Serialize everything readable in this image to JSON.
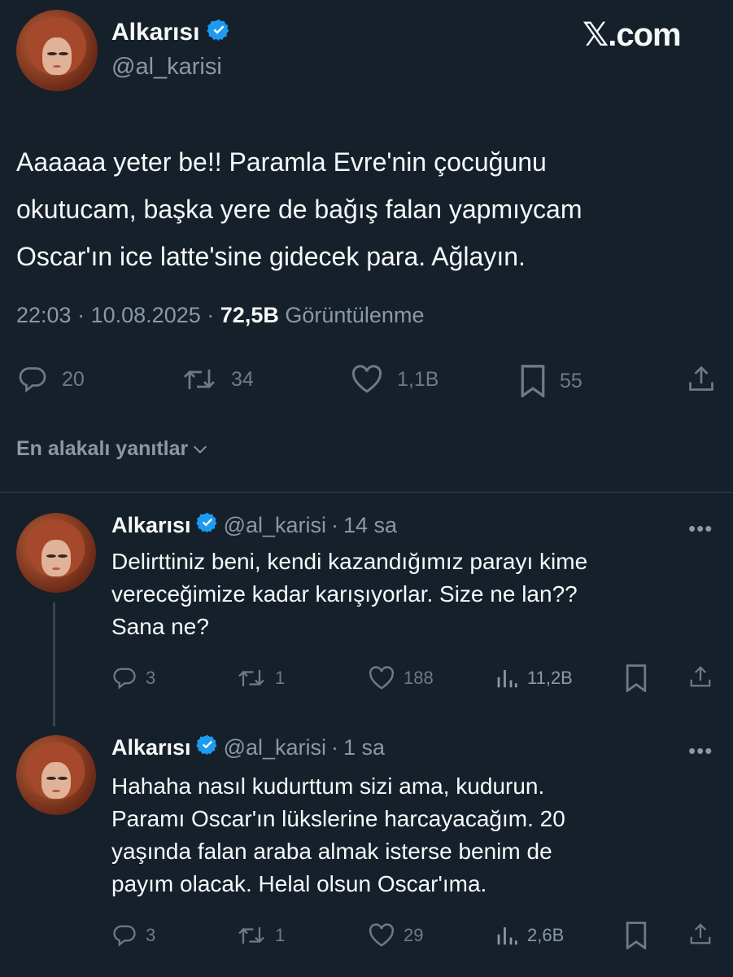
{
  "brand": {
    "logo_text": "𝕏.com"
  },
  "tweet": {
    "name": "Alkarısı",
    "handle": "@al_karisi",
    "text": "Aaaaaa yeter be!! Paramla Evre'nin çocuğunu\nokutucam, başka yere de bağış falan yapmıycam\nOscar'ın ice latte'sine gidecek para. Ağlayın.",
    "time": "22:03",
    "date": "10.08.2025",
    "views_count": "72,5B",
    "views_label": "Görüntülenme",
    "separator": "·",
    "actions": {
      "replies": "20",
      "reposts": "34",
      "likes": "1,1B",
      "bookmarks": "55"
    }
  },
  "sort": {
    "label": "En alakalı yanıtlar"
  },
  "replies": [
    {
      "name": "Alkarısı",
      "handle": "@al_karisi",
      "separator": "·",
      "time": "14 sa",
      "more": "•••",
      "text": "Delirttiniz beni, kendi kazandığımız parayı kime\nvereceğimize kadar karışıyorlar. Size ne lan??\nSana ne?",
      "actions": {
        "replies": "3",
        "reposts": "1",
        "likes": "188",
        "views": "11,2B"
      }
    },
    {
      "name": "Alkarısı",
      "handle": "@al_karisi",
      "separator": "·",
      "time": "1 sa",
      "more": "•••",
      "text": "Hahaha nasıl kudurttum sizi ama, kudurun.\nParamı Oscar'ın lükslerine harcayacağım. 20\nyaşında falan araba almak isterse benim de\npayım olacak. Helal olsun Oscar'ıma.",
      "actions": {
        "replies": "3",
        "reposts": "1",
        "likes": "29",
        "views": "2,6B"
      }
    }
  ],
  "colors": {
    "background": "#15202b",
    "verified": "#1d9bf0",
    "muted": "#8b98a5",
    "divider": "#38444d"
  }
}
